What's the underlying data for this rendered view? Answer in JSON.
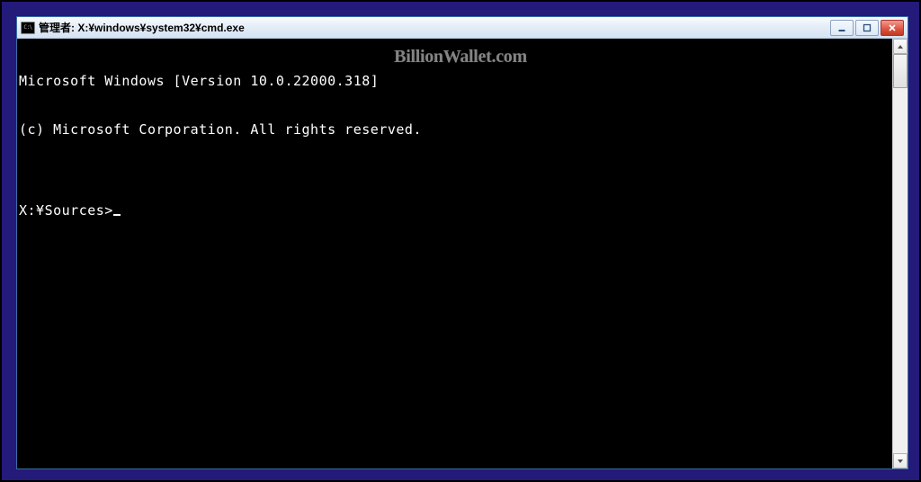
{
  "window": {
    "title": "管理者: X:¥windows¥system32¥cmd.exe",
    "icon_label": "C:\\"
  },
  "terminal": {
    "lines": [
      "Microsoft Windows [Version 10.0.22000.318]",
      "(c) Microsoft Corporation. All rights reserved.",
      "",
      "X:¥Sources>"
    ]
  },
  "watermark": "BillionWallet.com"
}
